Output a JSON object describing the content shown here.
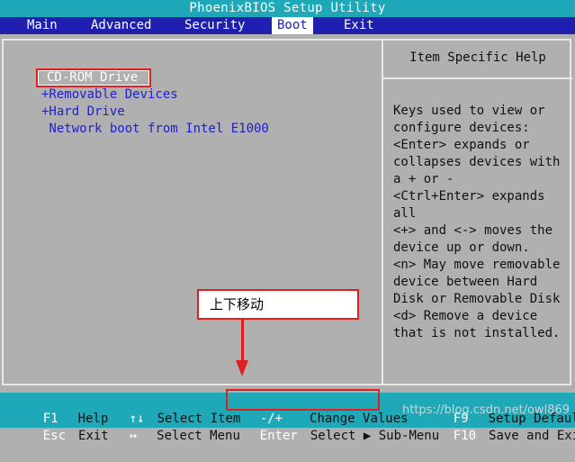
{
  "window": {
    "title": "PhoenixBIOS Setup Utility"
  },
  "menu": {
    "tabs": [
      {
        "label": "Main"
      },
      {
        "label": "Advanced"
      },
      {
        "label": "Security"
      },
      {
        "label": "Boot"
      },
      {
        "label": "Exit"
      }
    ],
    "active": "Boot"
  },
  "boot": {
    "items": [
      {
        "label": "CD-ROM Drive",
        "selected": true
      },
      {
        "label": "+Removable Devices"
      },
      {
        "label": "+Hard Drive"
      },
      {
        "label": " Network boot from Intel E1000"
      }
    ]
  },
  "help": {
    "title": "Item Specific Help",
    "lines": [
      "Keys used to view or",
      "configure devices:",
      "<Enter> expands or",
      "collapses devices with",
      "a + or -",
      "<Ctrl+Enter> expands",
      "all",
      "<+> and <-> moves the",
      "device up or down.",
      "<n> May move removable",
      "device between Hard",
      "Disk or Removable Disk",
      "<d> Remove a device",
      "that is not installed."
    ]
  },
  "annotation": {
    "callout_text": "上下移动"
  },
  "footer": {
    "row1": [
      {
        "key": "F1",
        "desc": "Help"
      },
      {
        "key": "↑↓",
        "desc": "Select Item"
      },
      {
        "key": "-/+",
        "desc": "Change Values"
      },
      {
        "key": "F9",
        "desc": "Setup Defaults"
      }
    ],
    "row2": [
      {
        "key": "Esc",
        "desc": "Exit"
      },
      {
        "key": "↔",
        "desc": "Select Menu"
      },
      {
        "key": "Enter",
        "desc": "Select ▶ Sub-Menu"
      },
      {
        "key": "F10",
        "desc": "Save and Exit"
      }
    ]
  },
  "watermark": "https://blog.csdn.net/owl869",
  "colors": {
    "title_bar": "#1fa8b8",
    "menu_bar": "#1f1fb0",
    "body": "#b0b0b0",
    "highlight": "#e02020"
  }
}
